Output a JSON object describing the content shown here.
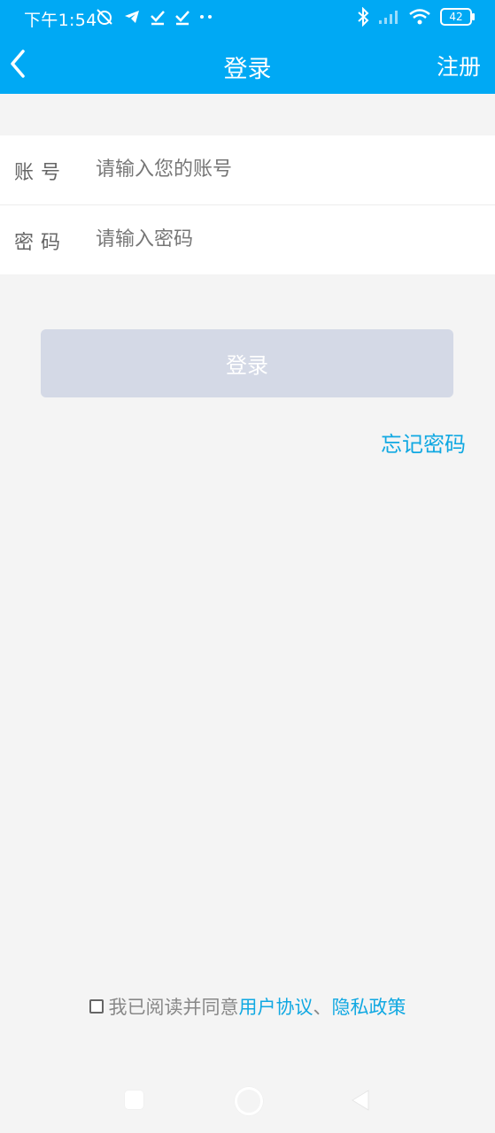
{
  "status_bar": {
    "time": "下午1:54",
    "battery": "42"
  },
  "header": {
    "title": "登录",
    "register_label": "注册"
  },
  "form": {
    "account": {
      "label": "账号",
      "placeholder": "请输入您的账号",
      "value": ""
    },
    "password": {
      "label": "密码",
      "placeholder": "请输入密码",
      "value": ""
    }
  },
  "login_button": {
    "label": "登录"
  },
  "forgot_password": "忘记密码",
  "agreement": {
    "prefix": "我已阅读并同意",
    "user_agreement": "用户协议",
    "separator": "、",
    "privacy_policy": "隐私政策"
  },
  "colors": {
    "accent": "#00a9f4",
    "link": "#10a8e2",
    "button_disabled": "#d4d9e6"
  }
}
